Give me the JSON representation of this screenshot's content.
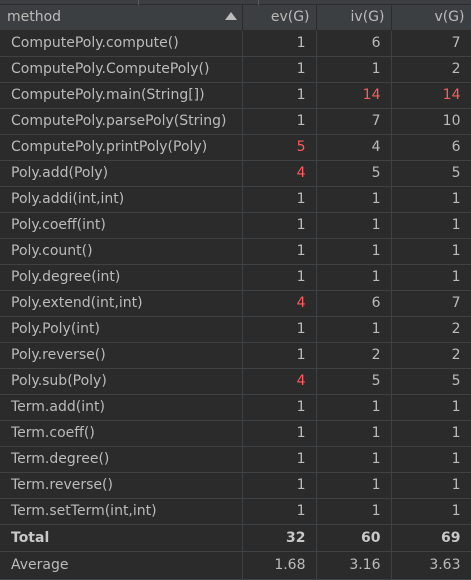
{
  "columns": [
    "method",
    "ev(G)",
    "iv(G)",
    "v(G)"
  ],
  "sort": {
    "column": "method",
    "direction": "ascending",
    "icon": "sort-ascending-icon"
  },
  "highlight_color": "#ff5b5b",
  "rows": [
    {
      "method": "ComputePoly.compute()",
      "ev": "1",
      "iv": "6",
      "v": "7",
      "hi": []
    },
    {
      "method": "ComputePoly.ComputePoly()",
      "ev": "1",
      "iv": "1",
      "v": "2",
      "hi": []
    },
    {
      "method": "ComputePoly.main(String[])",
      "ev": "1",
      "iv": "14",
      "v": "14",
      "hi": [
        "iv",
        "v"
      ]
    },
    {
      "method": "ComputePoly.parsePoly(String)",
      "ev": "1",
      "iv": "7",
      "v": "10",
      "hi": []
    },
    {
      "method": "ComputePoly.printPoly(Poly)",
      "ev": "5",
      "iv": "4",
      "v": "6",
      "hi": [
        "ev"
      ]
    },
    {
      "method": "Poly.add(Poly)",
      "ev": "4",
      "iv": "5",
      "v": "5",
      "hi": [
        "ev"
      ]
    },
    {
      "method": "Poly.addi(int,int)",
      "ev": "1",
      "iv": "1",
      "v": "1",
      "hi": []
    },
    {
      "method": "Poly.coeff(int)",
      "ev": "1",
      "iv": "1",
      "v": "1",
      "hi": []
    },
    {
      "method": "Poly.count()",
      "ev": "1",
      "iv": "1",
      "v": "1",
      "hi": []
    },
    {
      "method": "Poly.degree(int)",
      "ev": "1",
      "iv": "1",
      "v": "1",
      "hi": []
    },
    {
      "method": "Poly.extend(int,int)",
      "ev": "4",
      "iv": "6",
      "v": "7",
      "hi": [
        "ev"
      ]
    },
    {
      "method": "Poly.Poly(int)",
      "ev": "1",
      "iv": "1",
      "v": "2",
      "hi": []
    },
    {
      "method": "Poly.reverse()",
      "ev": "1",
      "iv": "2",
      "v": "2",
      "hi": []
    },
    {
      "method": "Poly.sub(Poly)",
      "ev": "4",
      "iv": "5",
      "v": "5",
      "hi": [
        "ev"
      ]
    },
    {
      "method": "Term.add(int)",
      "ev": "1",
      "iv": "1",
      "v": "1",
      "hi": []
    },
    {
      "method": "Term.coeff()",
      "ev": "1",
      "iv": "1",
      "v": "1",
      "hi": []
    },
    {
      "method": "Term.degree()",
      "ev": "1",
      "iv": "1",
      "v": "1",
      "hi": []
    },
    {
      "method": "Term.reverse()",
      "ev": "1",
      "iv": "1",
      "v": "1",
      "hi": []
    },
    {
      "method": "Term.setTerm(int,int)",
      "ev": "1",
      "iv": "1",
      "v": "1",
      "hi": []
    }
  ],
  "total": {
    "label": "Total",
    "ev": "32",
    "iv": "60",
    "v": "69"
  },
  "average": {
    "label": "Average",
    "ev": "1.68",
    "iv": "3.16",
    "v": "3.63"
  }
}
